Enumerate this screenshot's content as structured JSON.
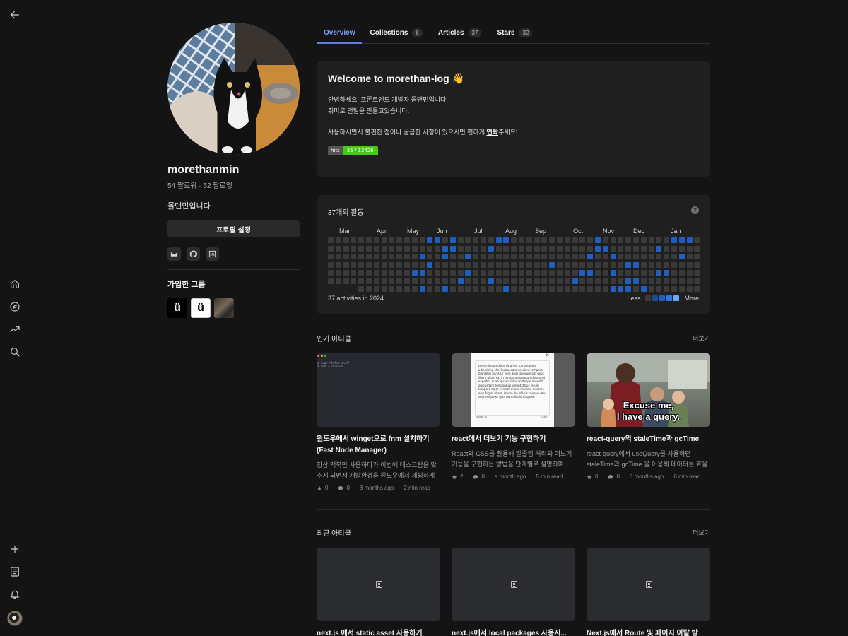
{
  "rail": {
    "icons": [
      "back-arrow-icon",
      "home-icon",
      "compass-icon",
      "trending-icon",
      "search-icon",
      "plus-icon",
      "document-icon",
      "bell-icon"
    ]
  },
  "profile": {
    "username": "morethanmin",
    "follow": "54 팔로워 · 52 팔로잉",
    "bio": "몰댄민입니다",
    "settings_label": "프로필 설정",
    "socials": [
      "mail-icon",
      "github-icon",
      "linkedin-icon"
    ],
    "groups_title": "가입한 그룹",
    "groups": [
      {
        "label": "ü"
      },
      {
        "label": "ü"
      },
      {
        "label": ""
      }
    ]
  },
  "tabs": [
    {
      "label": "Overview",
      "count": ""
    },
    {
      "label": "Collections",
      "count": "8"
    },
    {
      "label": "Articles",
      "count": "37"
    },
    {
      "label": "Stars",
      "count": "32"
    }
  ],
  "welcome": {
    "title": "Welcome to morethan-log 👋",
    "line1": "안녕하세요! 프론트엔드 개발자 몰댄민입니다.",
    "line2": "취미로 언틸을 만들고있습니다.",
    "line3_pre": "사용하시면서 불편한 점이나 궁금한 사항이 있으시면 편하게 ",
    "line3_link": "연락",
    "line3_post": "주세요!",
    "hits_label": "hits",
    "hits_value": "35 / 13426"
  },
  "activity": {
    "title": "37개의 활동",
    "help": "?",
    "months": [
      "Mar",
      "Apr",
      "May",
      "Jun",
      "Jul",
      "Aug",
      "Sep",
      "Oct",
      "Nov",
      "Dec",
      "Jan"
    ],
    "summary": "37 activities in 2024",
    "legend_less": "Less",
    "legend_more": "More",
    "colors": {
      "empty": "#3a3a3a",
      "active": "#1f5fbf",
      "legend": [
        "#3a3a3a",
        "#1a4a8f",
        "#1f5fbf",
        "#2f7ae0",
        "#6aa7ff"
      ]
    }
  },
  "popular": {
    "heading": "인기 아티클",
    "more": "더보기",
    "articles": [
      {
        "title": "윈도우에서 winget으로 fnm 설치하기 (Fast Node Manager)",
        "desc": "항상 맥북만 사용하다가 이번에 데스크탑을 맞추게 되면서 개발환경을 윈도우에서 세팅하게 되...",
        "stars": "0",
        "comments": "0",
        "ago": "8 months ago",
        "read": "2 min read",
        "thumb_text": "$ eval \"$(fnm env)\"\n$ fnm --version"
      },
      {
        "title": "react에서 더보기 기능 구현하기",
        "desc": "React와 CSS를 활용해 말줄임 처리와 더보기 기능을 구현하는 방법을 단계별로 설명하며, 애...",
        "stars": "2",
        "comments": "0",
        "ago": "a month ago",
        "read": "5 min read",
        "thumb_text": "Lorem ipsum dolor sit amet, consectetur adipisicing elit. Quibusdam nesciunt tempora blanditiis pariatur vero. Eius laborum aut quos libero ullam ex, in tempora excepturi dolore ad expedita quasi ipsam dolorum itaque impedit quibusdam temporibus voluptatibus rerum tempore dolor veniam minus maxime maiores eius fugiat ullam, labore illo officiis consequatur sunt neque et quia rem aliquid et quod!",
        "thumb_footer_left": "좋아요 · 0",
        "thumb_footer_right": "더보기"
      },
      {
        "title": "react-query의 staleTime과 gcTime",
        "desc": "react-query에서 useQuery를 사용하면 staleTime과 gcTime 을 이용해 데이터를 효율적으...",
        "stars": "0",
        "comments": "0",
        "ago": "8 months ago",
        "read": "6 min read",
        "thumb_text_1": "Excuse me,",
        "thumb_text_2": "I have a query."
      }
    ]
  },
  "recent": {
    "heading": "최근 아티클",
    "more": "더보기",
    "articles": [
      {
        "title": "next.js 에서 static asset 사용하기"
      },
      {
        "title": "next.js에서 local packages 사용시..."
      },
      {
        "title": "Next.js에서 Route 및 페이지 이탈 방지..."
      }
    ]
  }
}
